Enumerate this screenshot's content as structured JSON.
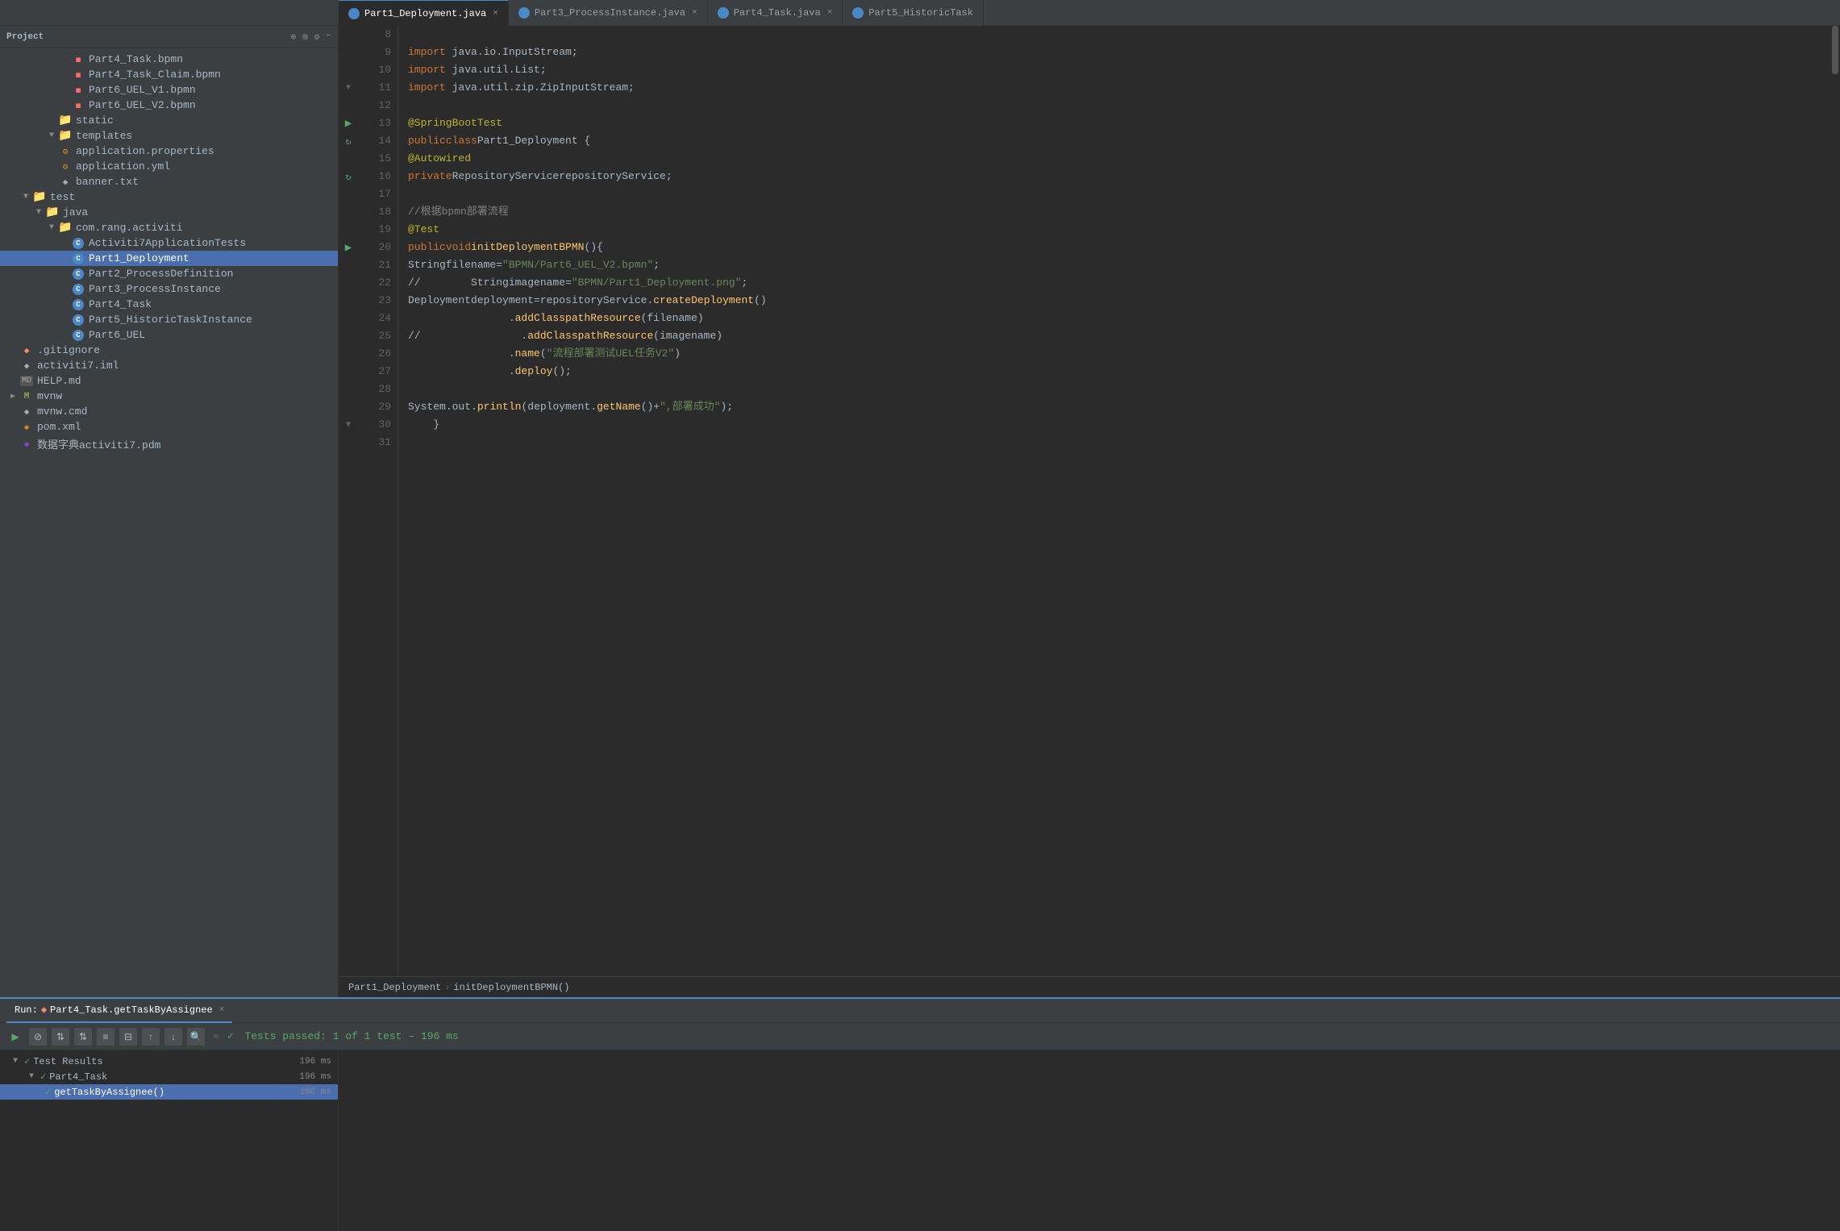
{
  "tabs": [
    {
      "id": "part1",
      "label": "Part1_Deployment.java",
      "active": true,
      "closable": true
    },
    {
      "id": "part3",
      "label": "Part3_ProcessInstance.java",
      "active": false,
      "closable": true
    },
    {
      "id": "part4",
      "label": "Part4_Task.java",
      "active": false,
      "closable": true
    },
    {
      "id": "part5",
      "label": "Part5_HistoricTask",
      "active": false,
      "closable": false
    }
  ],
  "sidebar": {
    "title": "Project",
    "tree": [
      {
        "indent": 4,
        "arrow": "",
        "iconClass": "icon-bpmn",
        "iconText": "■",
        "label": "Part4_Task.bpmn",
        "type": "file"
      },
      {
        "indent": 4,
        "arrow": "",
        "iconClass": "icon-bpmn",
        "iconText": "■",
        "label": "Part4_Task_Claim.bpmn",
        "type": "file"
      },
      {
        "indent": 4,
        "arrow": "",
        "iconClass": "icon-bpmn",
        "iconText": "■",
        "label": "Part6_UEL_V1.bpmn",
        "type": "file"
      },
      {
        "indent": 4,
        "arrow": "",
        "iconClass": "icon-bpmn",
        "iconText": "■",
        "label": "Part6_UEL_V2.bpmn",
        "type": "file"
      },
      {
        "indent": 3,
        "arrow": "",
        "iconClass": "icon-folder",
        "iconText": "▶",
        "label": "static",
        "type": "folder"
      },
      {
        "indent": 3,
        "arrow": "▼",
        "iconClass": "icon-folder-open",
        "iconText": "📁",
        "label": "templates",
        "type": "folder-open"
      },
      {
        "indent": 3,
        "arrow": "",
        "iconClass": "icon-properties",
        "iconText": "⚙",
        "label": "application.properties",
        "type": "file"
      },
      {
        "indent": 3,
        "arrow": "",
        "iconClass": "icon-yml",
        "iconText": "⚙",
        "label": "application.yml",
        "type": "file"
      },
      {
        "indent": 3,
        "arrow": "",
        "iconClass": "icon-txt",
        "iconText": "≡",
        "label": "banner.txt",
        "type": "file"
      },
      {
        "indent": 1,
        "arrow": "▼",
        "iconClass": "icon-folder-open",
        "iconText": "📁",
        "label": "test",
        "type": "folder-open"
      },
      {
        "indent": 2,
        "arrow": "▼",
        "iconClass": "icon-folder-open",
        "iconText": "📁",
        "label": "java",
        "type": "folder-open"
      },
      {
        "indent": 3,
        "arrow": "▼",
        "iconClass": "icon-folder-open",
        "iconText": "📁",
        "label": "com.rang.activiti",
        "type": "folder-open"
      },
      {
        "indent": 4,
        "arrow": "",
        "iconClass": "icon-java-test",
        "iconText": "C",
        "label": "Activiti7ApplicationTests",
        "type": "java",
        "selected": false
      },
      {
        "indent": 4,
        "arrow": "",
        "iconClass": "icon-java-test",
        "iconText": "C",
        "label": "Part1_Deployment",
        "type": "java",
        "selected": true
      },
      {
        "indent": 4,
        "arrow": "",
        "iconClass": "icon-java-test",
        "iconText": "C",
        "label": "Part2_ProcessDefinition",
        "type": "java",
        "selected": false
      },
      {
        "indent": 4,
        "arrow": "",
        "iconClass": "icon-java-test",
        "iconText": "C",
        "label": "Part3_ProcessInstance",
        "type": "java",
        "selected": false
      },
      {
        "indent": 4,
        "arrow": "",
        "iconClass": "icon-java-test",
        "iconText": "C",
        "label": "Part4_Task",
        "type": "java",
        "selected": false
      },
      {
        "indent": 4,
        "arrow": "",
        "iconClass": "icon-java-test",
        "iconText": "C",
        "label": "Part5_HistoricTaskInstance",
        "type": "java",
        "selected": false
      },
      {
        "indent": 4,
        "arrow": "",
        "iconClass": "icon-java-test",
        "iconText": "C",
        "label": "Part6_UEL",
        "type": "java",
        "selected": false
      },
      {
        "indent": 0,
        "arrow": "",
        "iconClass": "icon-git",
        "iconText": "◆",
        "label": ".gitignore",
        "type": "file"
      },
      {
        "indent": 0,
        "arrow": "",
        "iconClass": "icon-iml",
        "iconText": "◆",
        "label": "activiti7.iml",
        "type": "file"
      },
      {
        "indent": 0,
        "arrow": "",
        "iconClass": "icon-md",
        "iconText": "MD",
        "label": "HELP.md",
        "type": "file"
      },
      {
        "indent": 0,
        "arrow": "▶",
        "iconClass": "icon-mvnw",
        "iconText": "M",
        "label": "mvnw",
        "type": "file"
      },
      {
        "indent": 0,
        "arrow": "",
        "iconClass": "icon-cmd",
        "iconText": "◆",
        "label": "mvnw.cmd",
        "type": "file"
      },
      {
        "indent": 0,
        "arrow": "",
        "iconClass": "icon-xml",
        "iconText": "◆",
        "label": "pom.xml",
        "type": "file"
      },
      {
        "indent": 0,
        "arrow": "",
        "iconClass": "icon-pdm",
        "iconText": "◆",
        "label": "数据字典activiti7.pdm",
        "type": "file"
      }
    ]
  },
  "code_lines": [
    {
      "num": 8,
      "gutter": "",
      "content_html": ""
    },
    {
      "num": 9,
      "gutter": "",
      "content_html": "<span class='kw'>import</span> java.io.InputStream;"
    },
    {
      "num": 10,
      "gutter": "",
      "content_html": "<span class='kw'>import</span> java.util.List;"
    },
    {
      "num": 11,
      "gutter": "fold",
      "content_html": "<span class='kw'>import</span> java.util.zip.ZipInputStream;"
    },
    {
      "num": 12,
      "gutter": "",
      "content_html": ""
    },
    {
      "num": 13,
      "gutter": "green",
      "content_html": "<span class='ann'>@SpringBootTest</span>"
    },
    {
      "num": 14,
      "gutter": "green2",
      "content_html": "<span class='kw'>public</span> <span class='kw'>class</span> <span class='cls'>Part1_Deployment</span> {"
    },
    {
      "num": 15,
      "gutter": "",
      "content_html": "    <span class='ann'>@Autowired</span>"
    },
    {
      "num": 16,
      "gutter": "green3",
      "content_html": "    <span class='kw'>private</span> <span class='cls'>RepositoryService</span> <span class='var'>repositoryService</span>;"
    },
    {
      "num": 17,
      "gutter": "",
      "content_html": ""
    },
    {
      "num": 18,
      "gutter": "",
      "content_html": "    <span class='comment'>//根据bpmn部署流程</span>"
    },
    {
      "num": 19,
      "gutter": "",
      "content_html": "    <span class='ann'>@Test</span>"
    },
    {
      "num": 20,
      "gutter": "run",
      "content_html": "    <span class='kw'>public</span> <span class='kw'>void</span> <span class='fn'>initDeploymentBPMN</span>(){"
    },
    {
      "num": 21,
      "gutter": "",
      "content_html": "        <span class='cls'>String</span> <span class='var'>filename</span>=<span class='str'>\"BPMN/Part6_UEL_V2.bpmn\"</span>;"
    },
    {
      "num": 22,
      "gutter": "",
      "content_html": "//        <span class='cls'>String</span> <span class='var'>imagename</span>=<span class='str'>\"BPMN/Part1_Deployment.png\"</span>;"
    },
    {
      "num": 23,
      "gutter": "",
      "content_html": "        <span class='cls'>Deployment</span> <span class='var'>deployment</span>=<span class='var'>repositoryService</span>.<span class='fn'>createDeployment</span>()"
    },
    {
      "num": 24,
      "gutter": "",
      "content_html": "                .<span class='fn'>addClasspathResource</span>(<span class='var'>filename</span>)"
    },
    {
      "num": 25,
      "gutter": "",
      "content_html": "//                .<span class='fn'>addClasspathResource</span>(<span class='var'>imagename</span>)"
    },
    {
      "num": 26,
      "gutter": "",
      "content_html": "                .<span class='fn'>name</span>(<span class='str'>\"流程部署测试UEL任务V2\"</span>)"
    },
    {
      "num": 27,
      "gutter": "",
      "content_html": "                .<span class='fn'>deploy</span>();"
    },
    {
      "num": 28,
      "gutter": "",
      "content_html": ""
    },
    {
      "num": 29,
      "gutter": "",
      "content_html": "        <span class='cls'>System</span>.<span class='var'>out</span>.<span class='fn'>println</span>(<span class='var'>deployment</span>.<span class='fn'>getName</span>()+<span class='str'>\",部署成功\"</span>);"
    },
    {
      "num": 30,
      "gutter": "fold2",
      "content_html": "    }"
    },
    {
      "num": 31,
      "gutter": "",
      "content_html": ""
    }
  ],
  "breadcrumb": {
    "class_name": "Part1_Deployment",
    "sep": "›",
    "method_name": "initDeploymentBPMN()"
  },
  "bottom_panel": {
    "run_tab_label": "Run:",
    "run_task_label": "Part4_Task.getTaskByAssignee",
    "toolbar_buttons": [
      "▶",
      "⊘",
      "⇅",
      "⇅",
      "≡",
      "⊟",
      "↑",
      "↓",
      "🔍"
    ],
    "more_label": "»",
    "status_text": "Tests passed: 1 of 1 test – 196 ms",
    "tree_items": [
      {
        "label": "Test Results",
        "time": "196 ms",
        "indent": 0,
        "arrow": "▼",
        "check": true
      },
      {
        "label": "Part4_Task",
        "time": "196 ms",
        "indent": 1,
        "arrow": "▼",
        "check": true
      },
      {
        "label": "getTaskByAssignee()",
        "time": "196 ms",
        "indent": 2,
        "arrow": "",
        "check": true,
        "selected": true
      }
    ]
  }
}
